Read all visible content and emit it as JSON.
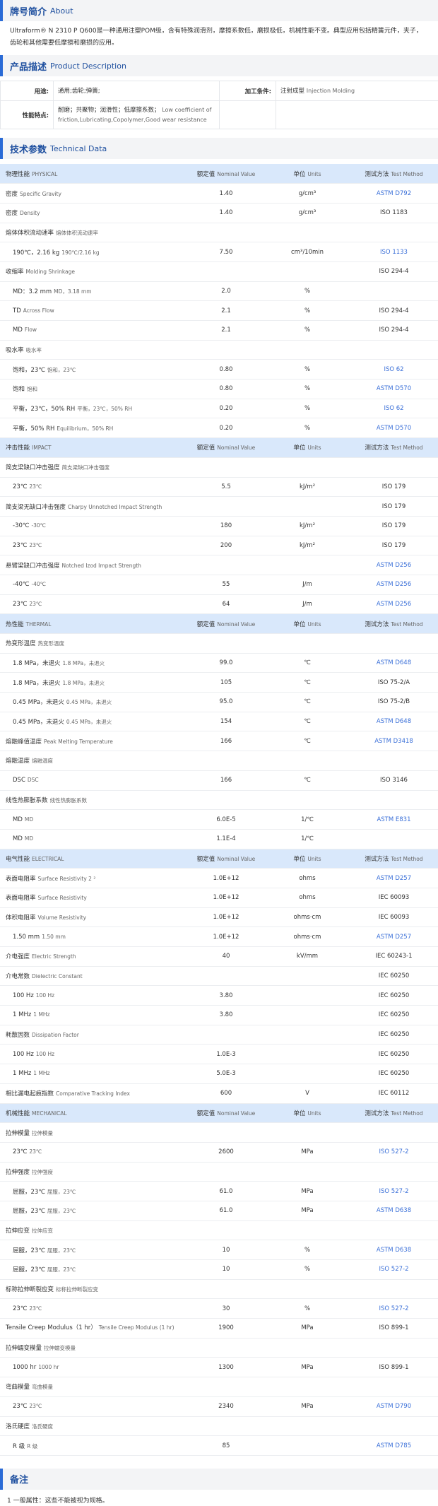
{
  "about": {
    "title": "牌号简介",
    "title_en": "About",
    "text": "Ultraform® N 2310 P Q600是一种通用注塑POM级，含有特殊润滑剂，摩擦系数低，磨损极低，机械性能不变。典型应用包括精簧元件，夹子，齿轮和其他需要低摩擦和磨损的应用。"
  },
  "description": {
    "title": "产品描述",
    "title_en": "Product Description",
    "use_label": "用途:",
    "use_value": "通用;齿轮;弹簧;",
    "process_label": "加工条件:",
    "process_value": "注射成型",
    "process_value_en": "Injection Molding",
    "feature_label": "性能特点:",
    "feature_value": "耐磨；共聚物；润滑性；低摩擦系数；",
    "feature_value_en": "Low coefficient of friction,Lubricating,Copolymer,Good wear resistance"
  },
  "tech": {
    "title": "技术参数",
    "title_en": "Technical Data",
    "rows": [
      {
        "cat": true,
        "name": "物理性能",
        "en": "PHYSICAL",
        "value": "额定值",
        "value_en": "Nominal Value",
        "unit": "单位",
        "unit_en": "Units",
        "method": "测试方法",
        "method_en": "Test Method"
      },
      {
        "name": "密度",
        "en": "Specific Gravity",
        "value": "1.40",
        "unit": "g/cm³",
        "method": "ASTM D792",
        "link": true
      },
      {
        "name": "密度",
        "en": "Density",
        "value": "1.40",
        "unit": "g/cm³",
        "method": "ISO 1183",
        "link": false
      },
      {
        "name": "熔体体积流动速率",
        "en": "熔体体积流动速率",
        "value": "",
        "unit": "",
        "method": "",
        "link": false
      },
      {
        "name": "190℃，2.16 kg",
        "en": "190℃/2.16 kg",
        "value": "7.50",
        "unit": "cm³/10min",
        "method": "ISO 1133",
        "link": true,
        "indent": true
      },
      {
        "name": "收缩率",
        "en": "Molding Shrinkage",
        "value": "",
        "unit": "",
        "method": "ISO 294-4",
        "link": false
      },
      {
        "name": "MD：3.2 mm",
        "en": "MD，3.18 mm",
        "value": "2.0",
        "unit": "%",
        "method": "",
        "link": false,
        "indent": true
      },
      {
        "name": "TD",
        "en": "Across Flow",
        "value": "2.1",
        "unit": "%",
        "method": "ISO 294-4",
        "link": false,
        "indent": true
      },
      {
        "name": "MD",
        "en": "Flow",
        "value": "2.1",
        "unit": "%",
        "method": "ISO 294-4",
        "link": false,
        "indent": true
      },
      {
        "name": "吸水率",
        "en": "吸水率",
        "value": "",
        "unit": "",
        "method": "",
        "link": false
      },
      {
        "name": "饱和，23℃",
        "en": "饱和，23℃",
        "value": "0.80",
        "unit": "%",
        "method": "ISO 62",
        "link": true,
        "indent": true
      },
      {
        "name": "饱和",
        "en": "饱和",
        "value": "0.80",
        "unit": "%",
        "method": "ASTM D570",
        "link": true,
        "indent": true
      },
      {
        "name": "平衡，23℃，50% RH",
        "en": "平衡，23℃，50% RH",
        "value": "0.20",
        "unit": "%",
        "method": "ISO 62",
        "link": true,
        "indent": true
      },
      {
        "name": "平衡，50% RH",
        "en": "Equilibrium，50% RH",
        "value": "0.20",
        "unit": "%",
        "method": "ASTM D570",
        "link": true,
        "indent": true
      },
      {
        "cat": true,
        "name": "冲击性能",
        "en": "IMPACT",
        "value": "额定值",
        "value_en": "Nominal Value",
        "unit": "单位",
        "unit_en": "Units",
        "method": "测试方法",
        "method_en": "Test Method"
      },
      {
        "name": "简支梁缺口冲击强度",
        "en": "简支梁缺口冲击强度",
        "value": "",
        "unit": "",
        "method": "",
        "link": false
      },
      {
        "name": "23℃",
        "en": "23℃",
        "value": "5.5",
        "unit": "kJ/m²",
        "method": "ISO 179",
        "link": false,
        "indent": true
      },
      {
        "name": "简支梁无缺口冲击强度",
        "en": "Charpy Unnotched Impact Strength",
        "value": "",
        "unit": "",
        "method": "ISO 179",
        "link": false
      },
      {
        "name": "-30℃",
        "en": "-30℃",
        "value": "180",
        "unit": "kJ/m²",
        "method": "ISO 179",
        "link": false,
        "indent": true
      },
      {
        "name": "23℃",
        "en": "23℃",
        "value": "200",
        "unit": "kJ/m²",
        "method": "ISO 179",
        "link": false,
        "indent": true
      },
      {
        "name": "悬臂梁缺口冲击强度",
        "en": "Notched Izod Impact Strength",
        "value": "",
        "unit": "",
        "method": "ASTM D256",
        "link": true
      },
      {
        "name": "-40℃",
        "en": "-40℃",
        "value": "55",
        "unit": "J/m",
        "method": "ASTM D256",
        "link": true,
        "indent": true
      },
      {
        "name": "23℃",
        "en": "23℃",
        "value": "64",
        "unit": "J/m",
        "method": "ASTM D256",
        "link": true,
        "indent": true
      },
      {
        "cat": true,
        "name": "热性能",
        "en": "THERMAL",
        "value": "额定值",
        "value_en": "Nominal Value",
        "unit": "单位",
        "unit_en": "Units",
        "method": "测试方法",
        "method_en": "Test Method"
      },
      {
        "name": "热变形温度",
        "en": "热变形温度",
        "value": "",
        "unit": "",
        "method": "",
        "link": false
      },
      {
        "name": "1.8 MPa，未退火",
        "en": "1.8 MPa，未退火",
        "value": "99.0",
        "unit": "℃",
        "method": "ASTM D648",
        "link": true,
        "indent": true
      },
      {
        "name": "1.8 MPa，未退火",
        "en": "1.8 MPa，未退火",
        "value": "105",
        "unit": "℃",
        "method": "ISO 75-2/A",
        "link": false,
        "indent": true
      },
      {
        "name": "0.45 MPa，未退火",
        "en": "0.45 MPa，未退火",
        "value": "95.0",
        "unit": "℃",
        "method": "ISO 75-2/B",
        "link": false,
        "indent": true
      },
      {
        "name": "0.45 MPa，未退火",
        "en": "0.45 MPa，未退火",
        "value": "154",
        "unit": "℃",
        "method": "ASTM D648",
        "link": true,
        "indent": true
      },
      {
        "name": "熔融峰值温度",
        "en": "Peak Melting Temperature",
        "value": "166",
        "unit": "℃",
        "method": "ASTM D3418",
        "link": true
      },
      {
        "name": "熔融温度",
        "en": "熔融温度",
        "value": "",
        "unit": "",
        "method": "",
        "link": false
      },
      {
        "name": "DSC",
        "en": "DSC",
        "value": "166",
        "unit": "℃",
        "method": "ISO 3146",
        "link": false,
        "indent": true
      },
      {
        "name": "线性热膨胀系数",
        "en": "线性热膨胀系数",
        "value": "",
        "unit": "",
        "method": "",
        "link": false
      },
      {
        "name": "MD",
        "en": "MD",
        "value": "6.0E-5",
        "unit": "1/℃",
        "method": "ASTM E831",
        "link": true,
        "indent": true
      },
      {
        "name": "MD",
        "en": "MD",
        "value": "1.1E-4",
        "unit": "1/℃",
        "method": "",
        "link": false,
        "indent": true
      },
      {
        "cat": true,
        "name": "电气性能",
        "en": "ELECTRICAL",
        "value": "额定值",
        "value_en": "Nominal Value",
        "unit": "单位",
        "unit_en": "Units",
        "method": "测试方法",
        "method_en": "Test Method"
      },
      {
        "name": "表面电阻率",
        "en": "Surface Resistivity  2 ²",
        "value": "1.0E+12",
        "unit": "ohms",
        "method": "ASTM D257",
        "link": true
      },
      {
        "name": "表面电阻率",
        "en": "Surface Resistivity",
        "value": "1.0E+12",
        "unit": "ohms",
        "method": "IEC 60093",
        "link": false
      },
      {
        "name": "体积电阻率",
        "en": "Volume Resistivity",
        "value": "1.0E+12",
        "unit": "ohms·cm",
        "method": "IEC 60093",
        "link": false
      },
      {
        "name": "1.50 mm",
        "en": "1.50 mm",
        "value": "1.0E+12",
        "unit": "ohms·cm",
        "method": "ASTM D257",
        "link": true,
        "indent": true
      },
      {
        "name": "介电强度",
        "en": "Electric Strength",
        "value": "40",
        "unit": "kV/mm",
        "method": "IEC 60243-1",
        "link": false
      },
      {
        "name": "介电常数",
        "en": "Dielectric Constant",
        "value": "",
        "unit": "",
        "method": "IEC 60250",
        "link": false
      },
      {
        "name": "100 Hz",
        "en": "100 Hz",
        "value": "3.80",
        "unit": "",
        "method": "IEC 60250",
        "link": false,
        "indent": true
      },
      {
        "name": "1 MHz",
        "en": "1 MHz",
        "value": "3.80",
        "unit": "",
        "method": "IEC 60250",
        "link": false,
        "indent": true
      },
      {
        "name": "耗散因数",
        "en": "Dissipation Factor",
        "value": "",
        "unit": "",
        "method": "IEC 60250",
        "link": false
      },
      {
        "name": "100 Hz",
        "en": "100 Hz",
        "value": "1.0E-3",
        "unit": "",
        "method": "IEC 60250",
        "link": false,
        "indent": true
      },
      {
        "name": "1 MHz",
        "en": "1 MHz",
        "value": "5.0E-3",
        "unit": "",
        "method": "IEC 60250",
        "link": false,
        "indent": true
      },
      {
        "name": "相比漏电起痕指数",
        "en": "Comparative Tracking Index",
        "value": "600",
        "unit": "V",
        "method": "IEC 60112",
        "link": false
      },
      {
        "cat": true,
        "name": "机械性能",
        "en": "MECHANICAL",
        "value": "额定值",
        "value_en": "Nominal Value",
        "unit": "单位",
        "unit_en": "Units",
        "method": "测试方法",
        "method_en": "Test Method"
      },
      {
        "name": "拉伸模量",
        "en": "拉伸模量",
        "value": "",
        "unit": "",
        "method": "",
        "link": false
      },
      {
        "name": "23℃",
        "en": "23℃",
        "value": "2600",
        "unit": "MPa",
        "method": "ISO 527-2",
        "link": true,
        "indent": true
      },
      {
        "name": "拉伸强度",
        "en": "拉伸强度",
        "value": "",
        "unit": "",
        "method": "",
        "link": false
      },
      {
        "name": "屈服，23℃",
        "en": "屈服，23℃",
        "value": "61.0",
        "unit": "MPa",
        "method": "ISO 527-2",
        "link": true,
        "indent": true
      },
      {
        "name": "屈服，23℃",
        "en": "屈服，23℃",
        "value": "61.0",
        "unit": "MPa",
        "method": "ASTM D638",
        "link": true,
        "indent": true
      },
      {
        "name": "拉伸应变",
        "en": "拉伸应变",
        "value": "",
        "unit": "",
        "method": "",
        "link": false
      },
      {
        "name": "屈服，23℃",
        "en": "屈服，23℃",
        "value": "10",
        "unit": "%",
        "method": "ASTM D638",
        "link": true,
        "indent": true
      },
      {
        "name": "屈服，23℃",
        "en": "屈服，23℃",
        "value": "10",
        "unit": "%",
        "method": "ISO 527-2",
        "link": true,
        "indent": true
      },
      {
        "name": "标称拉伸断裂应变",
        "en": "标称拉伸断裂应变",
        "value": "",
        "unit": "",
        "method": "",
        "link": false
      },
      {
        "name": "23℃",
        "en": "23℃",
        "value": "30",
        "unit": "%",
        "method": "ISO 527-2",
        "link": true,
        "indent": true
      },
      {
        "name": "Tensile Creep Modulus（1 hr）",
        "en": "Tensile Creep Modulus (1 hr)",
        "value": "1900",
        "unit": "MPa",
        "method": "ISO 899-1",
        "link": false,
        "wrap": true
      },
      {
        "name": "拉伸蠕变模量",
        "en": "拉伸蠕变模量",
        "value": "",
        "unit": "",
        "method": "",
        "link": false
      },
      {
        "name": "1000 hr",
        "en": "1000 hr",
        "value": "1300",
        "unit": "MPa",
        "method": "ISO 899-1",
        "link": false,
        "indent": true
      },
      {
        "name": "弯曲模量",
        "en": "弯曲模量",
        "value": "",
        "unit": "",
        "method": "",
        "link": false
      },
      {
        "name": "23℃",
        "en": "23℃",
        "value": "2340",
        "unit": "MPa",
        "method": "ASTM D790",
        "link": true,
        "indent": true
      },
      {
        "name": "洛氏硬度",
        "en": "洛氏硬度",
        "value": "",
        "unit": "",
        "method": "",
        "link": false
      },
      {
        "name": "R 级",
        "en": "R 级",
        "value": "85",
        "unit": "",
        "method": "ASTM D785",
        "link": true,
        "indent": true
      }
    ]
  },
  "notes": {
    "title": "备注",
    "text": "1 一般属性：这些不能被视为规格。"
  }
}
